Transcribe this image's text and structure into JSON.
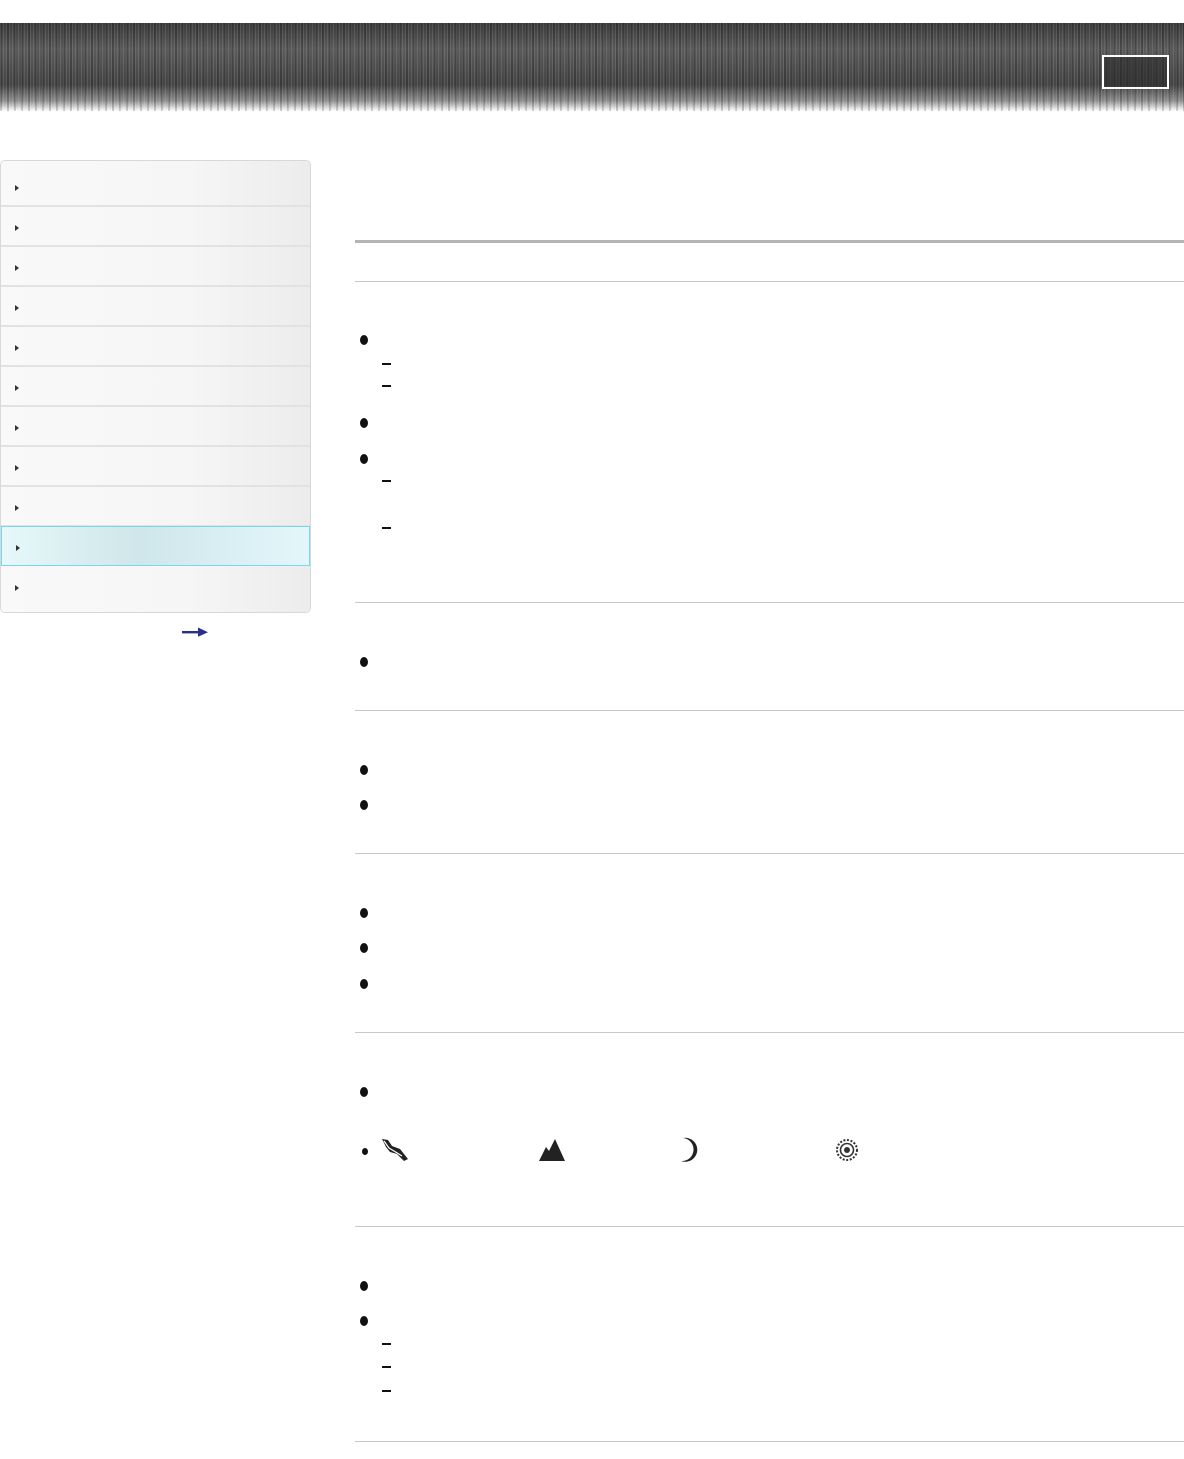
{
  "icons": {
    "more": "right-arrow-icon",
    "mode_1": "leaf-icon",
    "mode_2": "mountain-icon",
    "mode_3": "moon-icon",
    "mode_4": "gear-ring-icon"
  },
  "colors": {
    "active_nav": "#dff6fa",
    "active_border": "#7ad6ea",
    "arrow": "#2a2f8c"
  }
}
